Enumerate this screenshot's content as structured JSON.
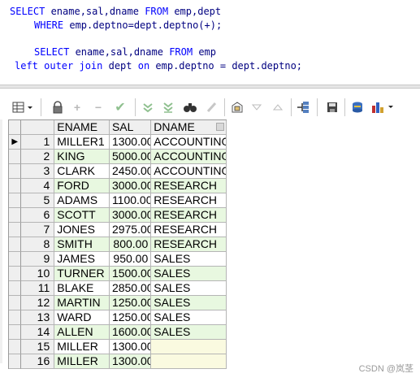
{
  "sql": {
    "line1": {
      "kw1": "SELECT",
      "cols": " ename,sal,dname ",
      "kw2": "FROM",
      "tables": " emp,dept"
    },
    "line2": {
      "kw1": "WHERE",
      "cond": " emp.deptno=dept.deptno(+);"
    },
    "line3": {
      "kw1": "SELECT",
      "cols": " ename,sal,dname ",
      "kw2": "FROM",
      "tables": " emp"
    },
    "line4": {
      "kw1": "left outer join",
      "tbl": " dept ",
      "kw2": "on",
      "cond": " emp.deptno = dept.deptno;"
    }
  },
  "toolbar": {
    "icons": [
      "grid-view-icon",
      "lock-icon",
      "add-record-icon",
      "delete-record-icon",
      "post-changes-icon",
      "filter-icon",
      "clear-filter-icon",
      "find-icon",
      "clear-icon",
      "query-by-example-icon",
      "previous-record-icon",
      "next-record-icon",
      "fetch-all-icon",
      "save-icon",
      "export-icon",
      "chart-icon"
    ]
  },
  "grid": {
    "headers": {
      "ename": "ENAME",
      "sal": "SAL",
      "dname": "DNAME"
    },
    "current_row_indicator": "▶",
    "rows": [
      {
        "num": "1",
        "ename": "MILLER1",
        "sal": "1300.00",
        "dname": "ACCOUNTING"
      },
      {
        "num": "2",
        "ename": "KING",
        "sal": "5000.00",
        "dname": "ACCOUNTING"
      },
      {
        "num": "3",
        "ename": "CLARK",
        "sal": "2450.00",
        "dname": "ACCOUNTING"
      },
      {
        "num": "4",
        "ename": "FORD",
        "sal": "3000.00",
        "dname": "RESEARCH"
      },
      {
        "num": "5",
        "ename": "ADAMS",
        "sal": "1100.00",
        "dname": "RESEARCH"
      },
      {
        "num": "6",
        "ename": "SCOTT",
        "sal": "3000.00",
        "dname": "RESEARCH"
      },
      {
        "num": "7",
        "ename": "JONES",
        "sal": "2975.00",
        "dname": "RESEARCH"
      },
      {
        "num": "8",
        "ename": "SMITH",
        "sal": "800.00",
        "dname": "RESEARCH"
      },
      {
        "num": "9",
        "ename": "JAMES",
        "sal": "950.00",
        "dname": "SALES"
      },
      {
        "num": "10",
        "ename": "TURNER",
        "sal": "1500.00",
        "dname": "SALES"
      },
      {
        "num": "11",
        "ename": "BLAKE",
        "sal": "2850.00",
        "dname": "SALES"
      },
      {
        "num": "12",
        "ename": "MARTIN",
        "sal": "1250.00",
        "dname": "SALES"
      },
      {
        "num": "13",
        "ename": "WARD",
        "sal": "1250.00",
        "dname": "SALES"
      },
      {
        "num": "14",
        "ename": "ALLEN",
        "sal": "1600.00",
        "dname": "SALES"
      },
      {
        "num": "15",
        "ename": "MILLER",
        "sal": "1300.00",
        "dname": ""
      },
      {
        "num": "16",
        "ename": "MILLER",
        "sal": "1300.00",
        "dname": ""
      }
    ]
  },
  "watermark": "CSDN @岚茎"
}
